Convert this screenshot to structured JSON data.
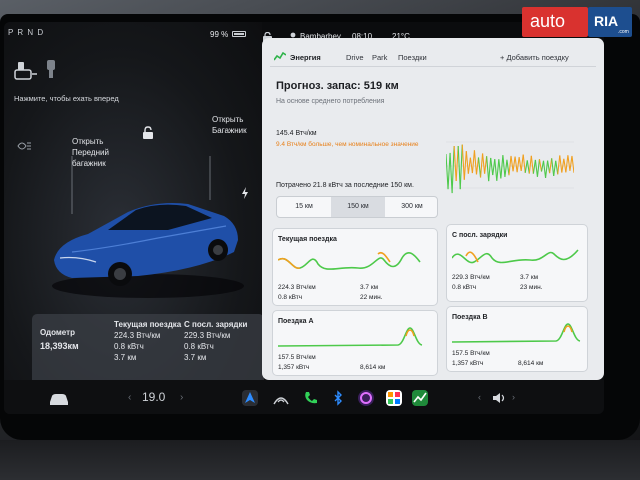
{
  "status": {
    "gears": "P R N D",
    "battery_percent": "99 %",
    "profile": "Bambarbey",
    "time": "08:10",
    "outside_temp": "21°C"
  },
  "left": {
    "hint": "Нажмите, чтобы ехать вперед",
    "open_frunk": "Открыть Передний багажник",
    "open_trunk": "Открыть Багажник",
    "stats": {
      "odometer_label": "Одометр",
      "odometer_value": "18,393км",
      "current_label": "Текущая поездка",
      "current_rate": "224.3 Втч/км",
      "current_energy": "0.8 кВтч",
      "current_distance": "3.7 км",
      "since_charge_label": "С посл. зарядки",
      "since_rate": "229.3 Втч/км",
      "since_energy": "0.8 кВтч",
      "since_distance": "3.7 км"
    },
    "climate_temp": "19.0"
  },
  "tabs": {
    "energy": "Энергия",
    "drive": "Drive",
    "park": "Park",
    "trips": "Поездки",
    "add_trip": "+ Добавить поездку"
  },
  "energy": {
    "range_title": "Прогноз. запас: 519 км",
    "subtitle": "На основе среднего потребления",
    "rate": "145.4 Втч/км",
    "warning": "9.4 Втч/км больше, чем номинальное значение",
    "consumed": "Потрачено 21.8 кВтч за последние 150 км.",
    "segments": [
      "15 км",
      "150 км",
      "300 км"
    ],
    "selected_segment": "150 км"
  },
  "trips": {
    "current": {
      "title": "Текущая поездка",
      "rate": "224.3 Втч/км",
      "energy": "0.8 кВтч",
      "distance": "3.7 км",
      "time": "22 мин."
    },
    "since_charge": {
      "title": "С посл. зарядки",
      "rate": "229.3 Втч/км",
      "energy": "0.8 кВтч",
      "distance": "3.7 км",
      "time": "23 мин."
    },
    "trip_a": {
      "title": "Поездка A",
      "rate": "157.5 Втч/км",
      "energy": "1,357 кВтч",
      "distance": "8,614 км"
    },
    "trip_b": {
      "title": "Поездка B",
      "rate": "157.5 Втч/км",
      "energy": "1,357 кВтч",
      "distance": "8,614 км"
    }
  },
  "watermark": {
    "text": "auto",
    "badge": "RIA",
    "domain": ".com"
  },
  "colors": {
    "accent_green": "#2fb34a",
    "warning_orange": "#e8801a",
    "curve_green": "#4dc94a",
    "curve_orange": "#f0a020"
  }
}
